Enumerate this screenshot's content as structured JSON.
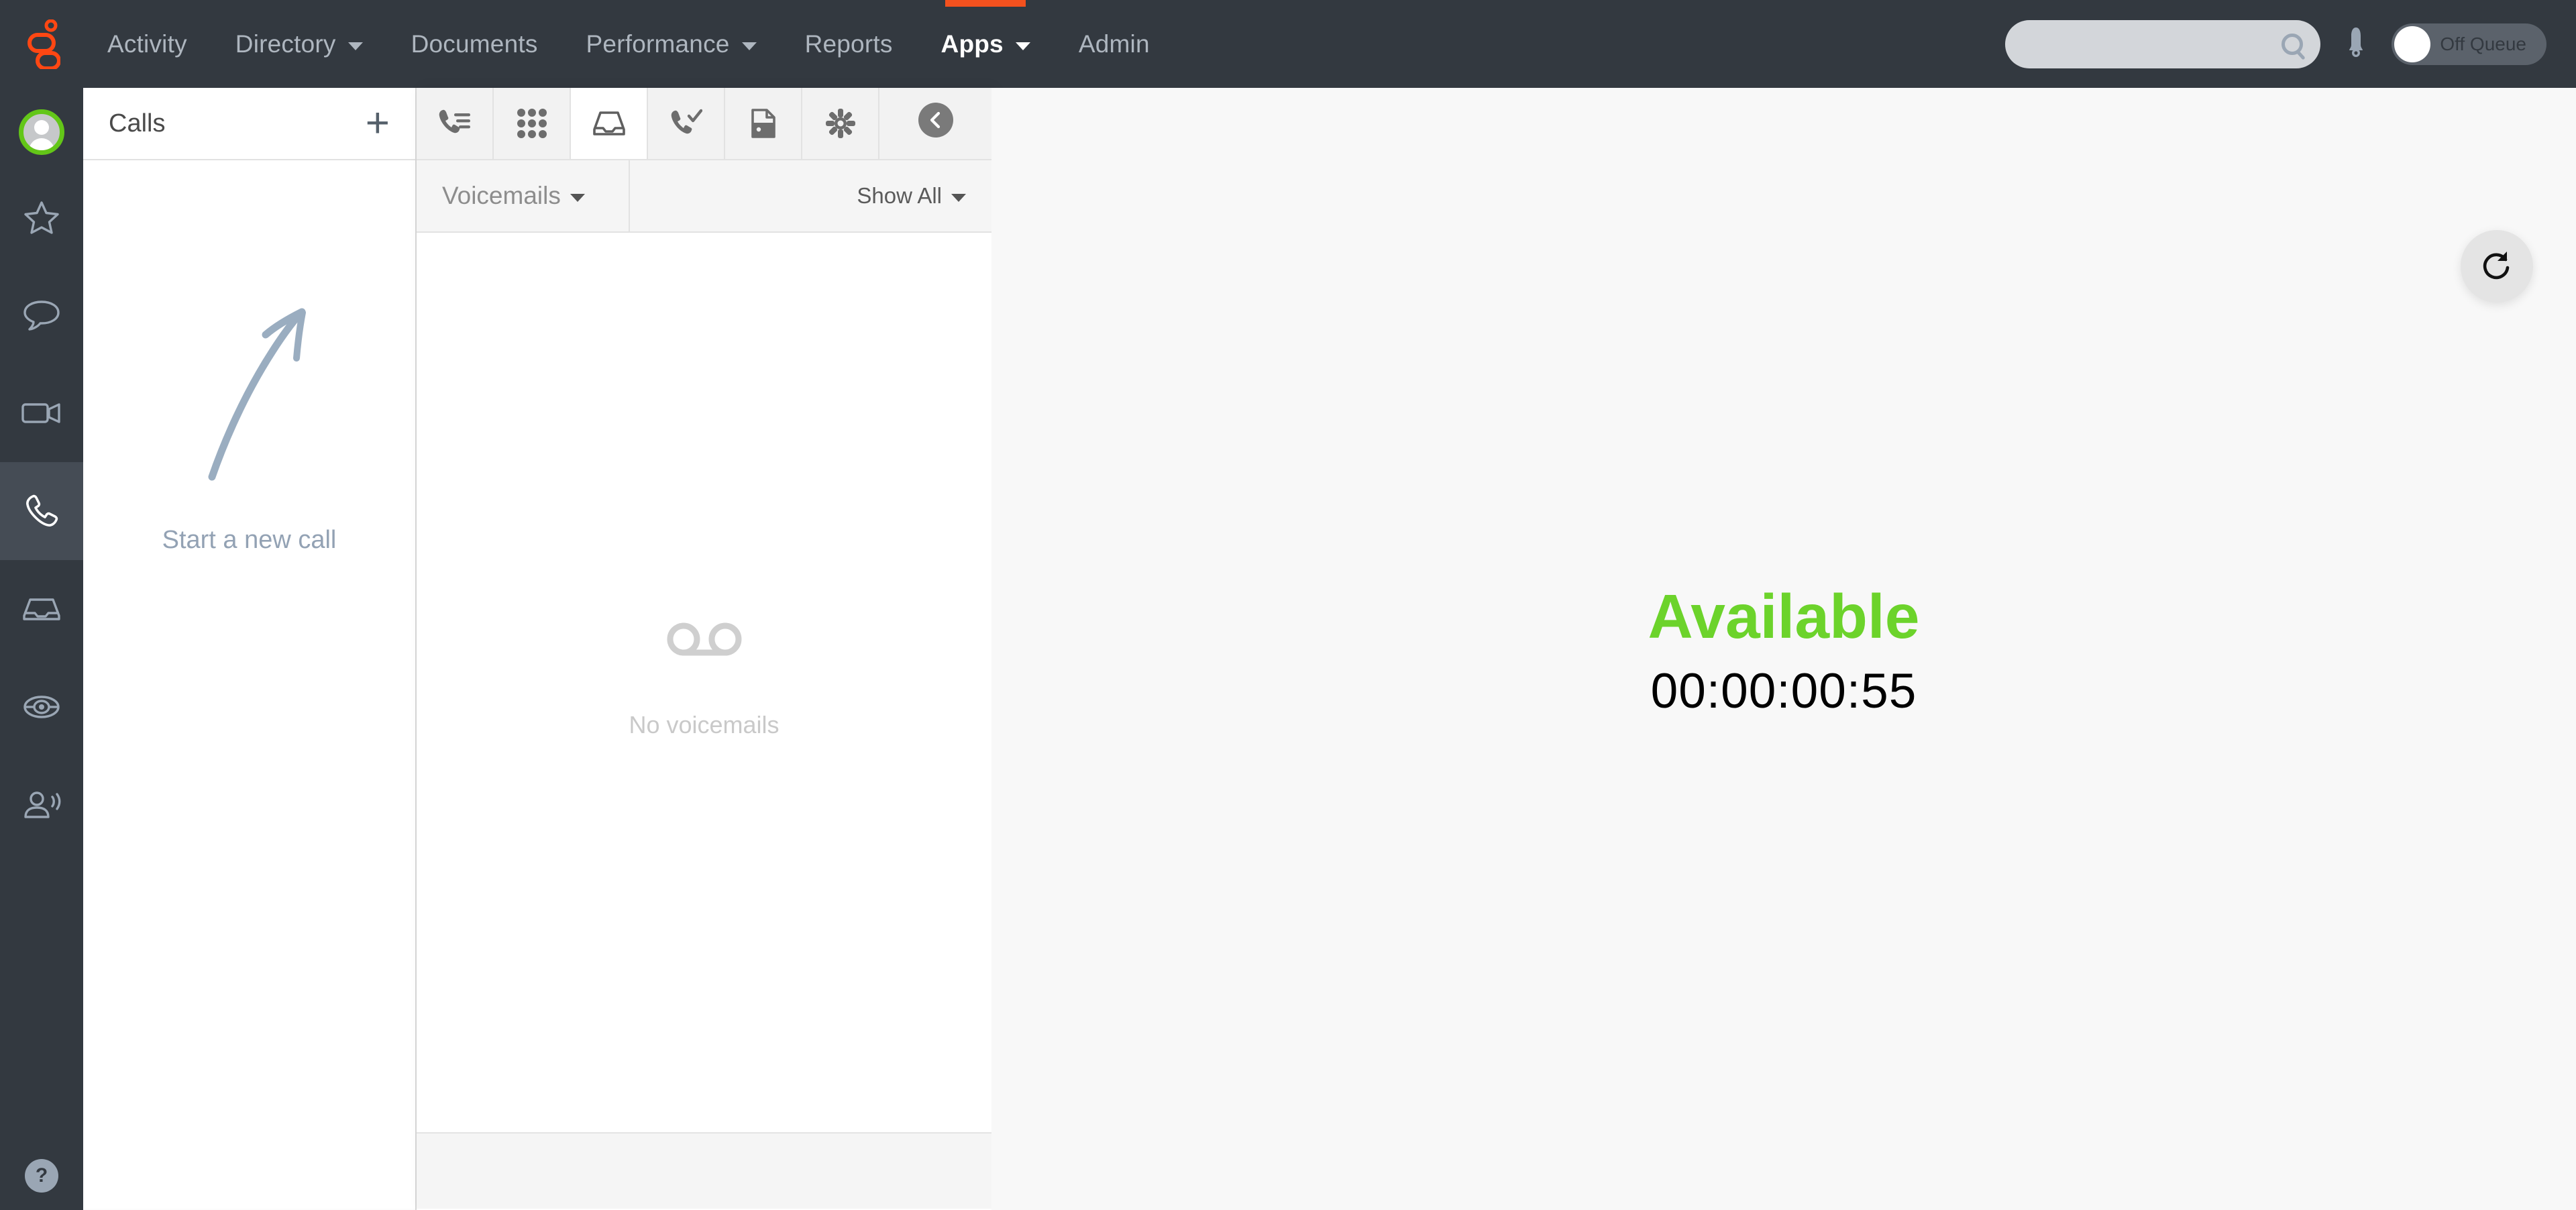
{
  "brand": {
    "logo_name": "genesys-logo",
    "accent_orange": "#f4511e",
    "nav_bg": "#333940",
    "status_green": "#6cd32b"
  },
  "topnav": {
    "items": [
      {
        "label": "Activity",
        "has_caret": false,
        "active": false
      },
      {
        "label": "Directory",
        "has_caret": true,
        "active": false
      },
      {
        "label": "Documents",
        "has_caret": false,
        "active": false
      },
      {
        "label": "Performance",
        "has_caret": true,
        "active": false
      },
      {
        "label": "Reports",
        "has_caret": false,
        "active": false
      },
      {
        "label": "Apps",
        "has_caret": true,
        "active": true
      },
      {
        "label": "Admin",
        "has_caret": false,
        "active": false
      }
    ],
    "search": {
      "value": "",
      "placeholder": "",
      "icon": "search-icon"
    },
    "notifications_icon": "bell-icon",
    "queue_toggle": {
      "label": "Off Queue",
      "state": "off"
    }
  },
  "rail": {
    "avatar": {
      "name": "user-avatar",
      "presence": "available"
    },
    "items": [
      {
        "icon": "star-icon",
        "name": "favorites",
        "selected": false
      },
      {
        "icon": "chat-bubble-icon",
        "name": "chat",
        "selected": false
      },
      {
        "icon": "video-camera-icon",
        "name": "video",
        "selected": false
      },
      {
        "icon": "phone-handset-icon",
        "name": "calls",
        "selected": true
      },
      {
        "icon": "inbox-tray-icon",
        "name": "inbox",
        "selected": false
      },
      {
        "icon": "target-eye-icon",
        "name": "supervisor",
        "selected": false
      },
      {
        "icon": "person-speaking-icon",
        "name": "contact-center",
        "selected": false
      }
    ],
    "help": {
      "icon": "help-question-icon",
      "label": "?"
    }
  },
  "calls_panel": {
    "title": "Calls",
    "add_button_label": "+",
    "empty_hint": "Start a new call",
    "arrow_icon": "hand-drawn-up-right-arrow"
  },
  "interaction_panel": {
    "tools": [
      {
        "icon": "phone-list-icon",
        "name": "call-history",
        "active": false
      },
      {
        "icon": "dialpad-icon",
        "name": "dialpad",
        "active": false
      },
      {
        "icon": "inbox-tray-icon",
        "name": "voicemail-inbox",
        "active": true
      },
      {
        "icon": "phone-check-icon",
        "name": "callback",
        "active": false
      },
      {
        "icon": "secure-document-icon",
        "name": "secure-pause",
        "active": false
      },
      {
        "icon": "gear-icon",
        "name": "settings",
        "active": false
      }
    ],
    "collapse_icon": "chevron-left-circle-icon",
    "filter": {
      "category_label": "Voicemails",
      "category_caret": "chevron-down-icon",
      "show_label": "Show All",
      "show_caret": "chevron-down-icon"
    },
    "empty_state": {
      "icon": "voicemail-icon",
      "label": "No voicemails"
    }
  },
  "stage": {
    "refresh_icon": "refresh-icon",
    "status_label": "Available",
    "timer": "00:00:00:55",
    "cursor_icon": "mouse-pointer"
  }
}
